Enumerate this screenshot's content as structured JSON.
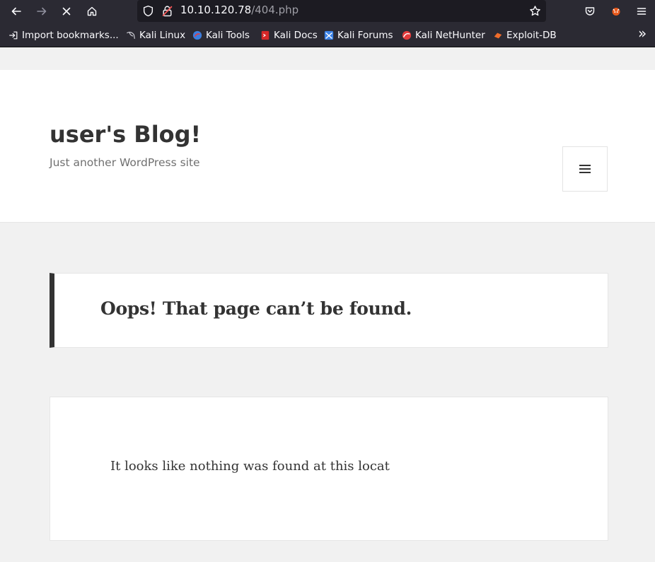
{
  "browser": {
    "url_host": "10.10.120.78",
    "url_path": "/404.php",
    "bookmarks": [
      {
        "label": "Import bookmarks...",
        "icon": "import-icon"
      },
      {
        "label": "Kali Linux",
        "icon": "kali-dragon-icon"
      },
      {
        "label": "Kali Tools",
        "icon": "kali-tools-icon"
      },
      {
        "label": "Kali Docs",
        "icon": "kali-docs-icon"
      },
      {
        "label": "Kali Forums",
        "icon": "kali-forums-icon"
      },
      {
        "label": "Kali NetHunter",
        "icon": "kali-nethunter-icon"
      },
      {
        "label": "Exploit-DB",
        "icon": "exploit-db-icon"
      }
    ],
    "overflow_glyph": "»"
  },
  "site": {
    "title": "user's Blog!",
    "description": "Just another WordPress site"
  },
  "content": {
    "heading": "Oops! That page can’t be found.",
    "message": "It looks like nothing was found at this locat"
  },
  "colors": {
    "chrome_bg": "#2b2a33",
    "urlbar_bg": "#1c1b22",
    "page_bg": "#f1f1f1",
    "accent_border": "#333333"
  }
}
